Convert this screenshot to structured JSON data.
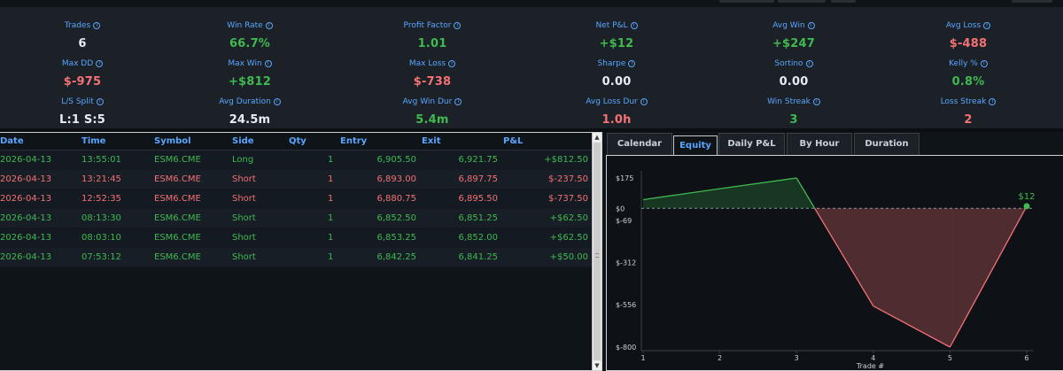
{
  "stats": [
    {
      "label": "Trades",
      "value": "6",
      "color": "#e6edf3"
    },
    {
      "label": "Win Rate",
      "value": "66.7%",
      "color": "#3fb950"
    },
    {
      "label": "Profit Factor",
      "value": "1.01",
      "color": "#3fb950"
    },
    {
      "label": "Net P&L",
      "value": "+$12",
      "color": "#3fb950"
    },
    {
      "label": "Avg Win",
      "value": "+$247",
      "color": "#3fb950"
    },
    {
      "label": "Avg Loss",
      "value": "$-488",
      "color": "#f47174"
    },
    {
      "label": "Max DD",
      "value": "$-975",
      "color": "#f47174"
    },
    {
      "label": "Max Win",
      "value": "+$812",
      "color": "#3fb950"
    },
    {
      "label": "Max Loss",
      "value": "$-738",
      "color": "#f47174"
    },
    {
      "label": "Sharpe",
      "value": "0.00",
      "color": "#e6edf3"
    },
    {
      "label": "Sortino",
      "value": "0.00",
      "color": "#e6edf3"
    },
    {
      "label": "Kelly %",
      "value": "0.8%",
      "color": "#3fb950"
    },
    {
      "label": "L/S Split",
      "value": "L:1 S:5",
      "color": "#e6edf3"
    },
    {
      "label": "Avg Duration",
      "value": "24.5m",
      "color": "#e6edf3"
    },
    {
      "label": "Avg Win Dur",
      "value": "5.4m",
      "color": "#3fb950"
    },
    {
      "label": "Avg Loss Dur",
      "value": "1.0h",
      "color": "#f47174"
    },
    {
      "label": "Win Streak",
      "value": "3",
      "color": "#3fb950"
    },
    {
      "label": "Loss Streak",
      "value": "2",
      "color": "#f47174"
    }
  ],
  "table": {
    "columns": [
      "Date",
      "Time",
      "Symbol",
      "Side",
      "Qty",
      "Entry",
      "Exit",
      "P&L"
    ],
    "rows": [
      {
        "date": "2026-04-13",
        "time": "13:55:01",
        "symbol": "ESM6.CME",
        "side": "Long",
        "qty": "1",
        "entry": "6,905.50",
        "exit": "6,921.75",
        "pnl": "+$812.50",
        "color": "#3fb950"
      },
      {
        "date": "2026-04-13",
        "time": "13:21:45",
        "symbol": "ESM6.CME",
        "side": "Short",
        "qty": "1",
        "entry": "6,893.00",
        "exit": "6,897.75",
        "pnl": "$-237.50",
        "color": "#f47174"
      },
      {
        "date": "2026-04-13",
        "time": "12:52:35",
        "symbol": "ESM6.CME",
        "side": "Short",
        "qty": "1",
        "entry": "6,880.75",
        "exit": "6,895.50",
        "pnl": "$-737.50",
        "color": "#f47174"
      },
      {
        "date": "2026-04-13",
        "time": "08:13:30",
        "symbol": "ESM6.CME",
        "side": "Short",
        "qty": "1",
        "entry": "6,852.50",
        "exit": "6,851.25",
        "pnl": "+$62.50",
        "color": "#3fb950"
      },
      {
        "date": "2026-04-13",
        "time": "08:03:10",
        "symbol": "ESM6.CME",
        "side": "Short",
        "qty": "1",
        "entry": "6,853.25",
        "exit": "6,852.00",
        "pnl": "+$62.50",
        "color": "#3fb950"
      },
      {
        "date": "2026-04-13",
        "time": "07:53:12",
        "symbol": "ESM6.CME",
        "side": "Short",
        "qty": "1",
        "entry": "6,842.25",
        "exit": "6,841.25",
        "pnl": "+$50.00",
        "color": "#3fb950"
      }
    ]
  },
  "tabs": [
    {
      "label": "Calendar",
      "active": false
    },
    {
      "label": "Equity",
      "active": true
    },
    {
      "label": "Daily P&L",
      "active": false
    },
    {
      "label": "By Hour",
      "active": false
    },
    {
      "label": "Duration",
      "active": false
    }
  ],
  "chart_data": {
    "type": "line",
    "x": [
      1,
      2,
      3,
      4,
      5,
      6
    ],
    "series": [
      {
        "values": [
          50,
          113,
          175,
          -563,
          -800,
          12
        ]
      }
    ],
    "xlabel": "Trade #",
    "ylabel": "",
    "xticks": [
      "1",
      "2",
      "3",
      "4",
      "5",
      "6"
    ],
    "yticks": [
      "$175",
      "$0",
      "$-69",
      "$-312",
      "$-556",
      "$-800"
    ],
    "ylim": [
      -800,
      175
    ],
    "end_label": "$12",
    "colors": {
      "up": "#3fb950",
      "down": "#f47174",
      "zero_line": "#8b949e"
    }
  }
}
